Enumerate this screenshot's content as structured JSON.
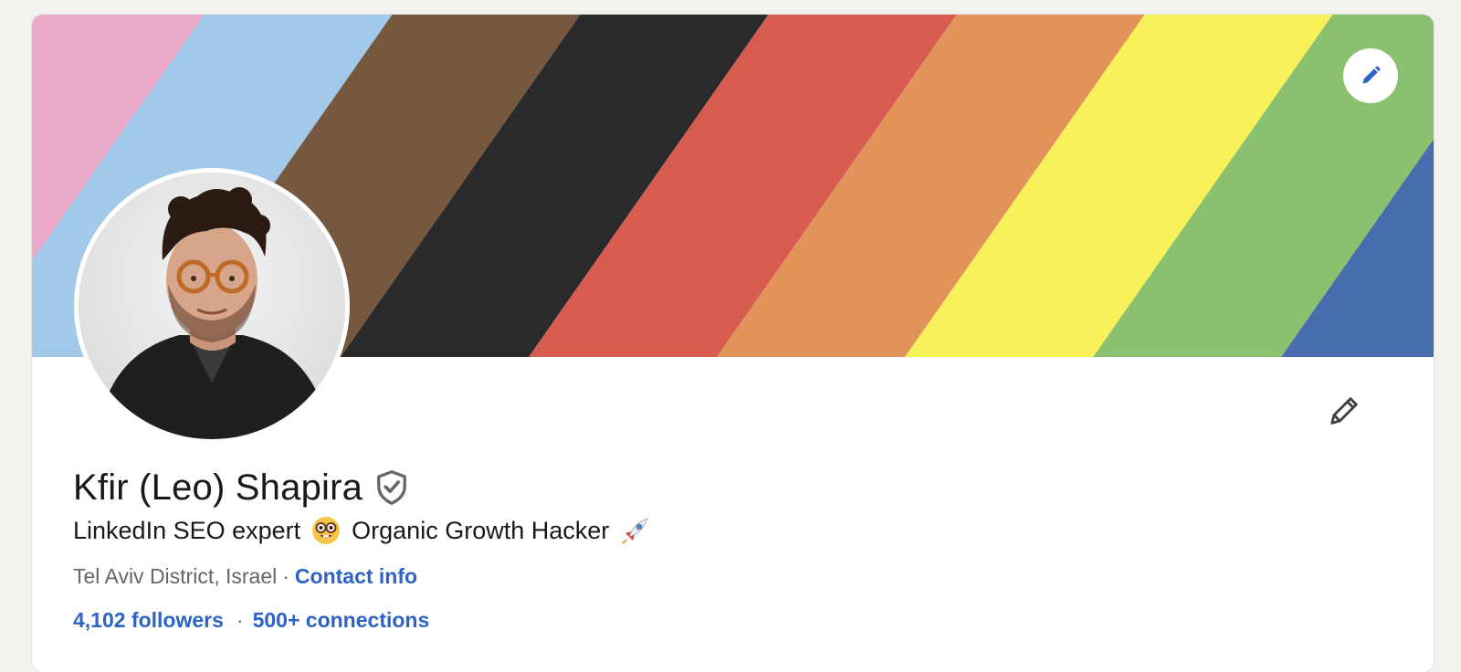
{
  "profile": {
    "name": "Kfir (Leo) Shapira",
    "headline_part1": "LinkedIn SEO expert",
    "headline_part2": "Organic Growth Hacker",
    "location": "Tel Aviv District, Israel",
    "separator": "·",
    "contact_info": "Contact info",
    "followers": "4,102 followers",
    "connections": "500+ connections"
  },
  "icons": {
    "banner_edit": "pencil-icon",
    "intro_edit": "pencil-icon",
    "verified": "shield-check-icon",
    "emoji_1": "nerd-face-emoji",
    "emoji_2": "rocket-emoji"
  },
  "colors": {
    "link": "#2d63c6",
    "text": "#191919",
    "muted": "#666666",
    "background": "#f3f2ef",
    "banner_stripes": [
      "#eaa9c8",
      "#a2c8ea",
      "#75583e",
      "#2a2a2c",
      "#d85b4f",
      "#e2935a",
      "#f8f15a",
      "#89c16f",
      "#476dae",
      "#9b4e9c"
    ]
  }
}
